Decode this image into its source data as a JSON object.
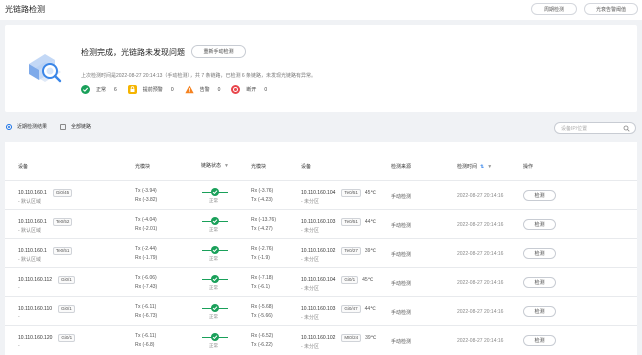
{
  "header": {
    "title": "光链路检测",
    "periodic_btn": "周期检测",
    "optical_alarm_btn": "光衰告警阈值"
  },
  "summary": {
    "result_title": "检测完成，光链路未发现问题",
    "recheck_btn": "重新手动检测",
    "last_check": "上次检测时间是2022-08-27 20:14:13（手动检测），共 7 条链路，已检测 6 条链路，未发现光链路有异常。",
    "stats": [
      {
        "label": "正常",
        "count": "6",
        "color": "#1aa05a",
        "icon": "check-circle-icon"
      },
      {
        "label": "提前预警",
        "count": "0",
        "color": "#f5b400",
        "icon": "warning-lock-icon"
      },
      {
        "label": "告警",
        "count": "0",
        "color": "#f58220",
        "icon": "alert-triangle-icon"
      },
      {
        "label": "断开",
        "count": "0",
        "color": "#e8454b",
        "icon": "disconnect-icon"
      }
    ]
  },
  "filter": {
    "option_recent": "近期检测结果",
    "option_all": "全部链路",
    "search_placeholder": "设备IP/位置"
  },
  "table": {
    "columns": {
      "device": "设备",
      "module": "光模块",
      "link_status": "链路状态",
      "module2": "光模块",
      "device2": "设备",
      "source": "检测来源",
      "time": "检测时间",
      "action": "操作"
    },
    "rows": [
      {
        "ip": "10.110.160.1",
        "port": "Gi0/45",
        "loc": "- 默认区域",
        "tx": "Tx (-3.94)",
        "rx": "Rx (-3.82)",
        "status": "正常",
        "rx2": "Rx (-3.76)",
        "tx2": "Tx (-4.23)",
        "ip2": "10.110.160.104",
        "port2": "Te0/51",
        "temp": "45℃",
        "loc2": "- 未分区",
        "source": "手动检测",
        "time": "2022-08-27 20:14:16",
        "action": "检测"
      },
      {
        "ip": "10.110.160.1",
        "port": "Te0/52",
        "loc": "- 默认区域",
        "tx": "Tx (-4.04)",
        "rx": "Rx (-2.01)",
        "status": "正常",
        "rx2": "Rx (-13.76)",
        "tx2": "Tx (-4.27)",
        "ip2": "10.110.160.103",
        "port2": "Te0/51",
        "temp": "44℃",
        "loc2": "- 未分区",
        "source": "手动检测",
        "time": "2022-08-27 20:14:16",
        "action": "检测"
      },
      {
        "ip": "10.110.160.1",
        "port": "Te0/51",
        "loc": "- 默认区域",
        "tx": "Tx (-2.44)",
        "rx": "Rx (-1.79)",
        "status": "正常",
        "rx2": "Rx (-2.76)",
        "tx2": "Tx (-1.9)",
        "ip2": "10.110.160.102",
        "port2": "Te0/27",
        "temp": "39℃",
        "loc2": "- 未分区",
        "source": "手动检测",
        "time": "2022-08-27 20:14:16",
        "action": "检测"
      },
      {
        "ip": "10.110.160.112",
        "port": "Gi0/1",
        "loc": "-",
        "tx": "Tx (-6.06)",
        "rx": "Rx (-7.43)",
        "status": "正常",
        "rx2": "Rx (-7.18)",
        "tx2": "Tx (-6.1)",
        "ip2": "10.110.160.104",
        "port2": "Gi0/1",
        "temp": "45℃",
        "loc2": "- 未分区",
        "source": "手动检测",
        "time": "2022-08-27 20:14:16",
        "action": "检测"
      },
      {
        "ip": "10.110.160.110",
        "port": "Gi0/1",
        "loc": "-",
        "tx": "Tx (-6.11)",
        "rx": "Rx (-6.73)",
        "status": "正常",
        "rx2": "Rx (-5.68)",
        "tx2": "Tx (-5.66)",
        "ip2": "10.110.160.103",
        "port2": "Gi0/47",
        "temp": "44℃",
        "loc2": "- 未分区",
        "source": "手动检测",
        "time": "2022-08-27 20:14:16",
        "action": "检测"
      },
      {
        "ip": "10.110.160.120",
        "port": "Gi0/1",
        "loc": "-",
        "tx": "Tx (-6.11)",
        "rx": "Rx (-6.8)",
        "status": "正常",
        "rx2": "Rx (-6.52)",
        "tx2": "Tx (-6.22)",
        "ip2": "10.110.160.102",
        "port2": "Mt0/24",
        "temp": "39℃",
        "loc2": "- 未分区",
        "source": "手动检测",
        "time": "2022-08-27 20:14:16",
        "action": "检测"
      }
    ]
  },
  "colors": {
    "accent": "#1a73e8",
    "normal": "#1aa05a"
  }
}
